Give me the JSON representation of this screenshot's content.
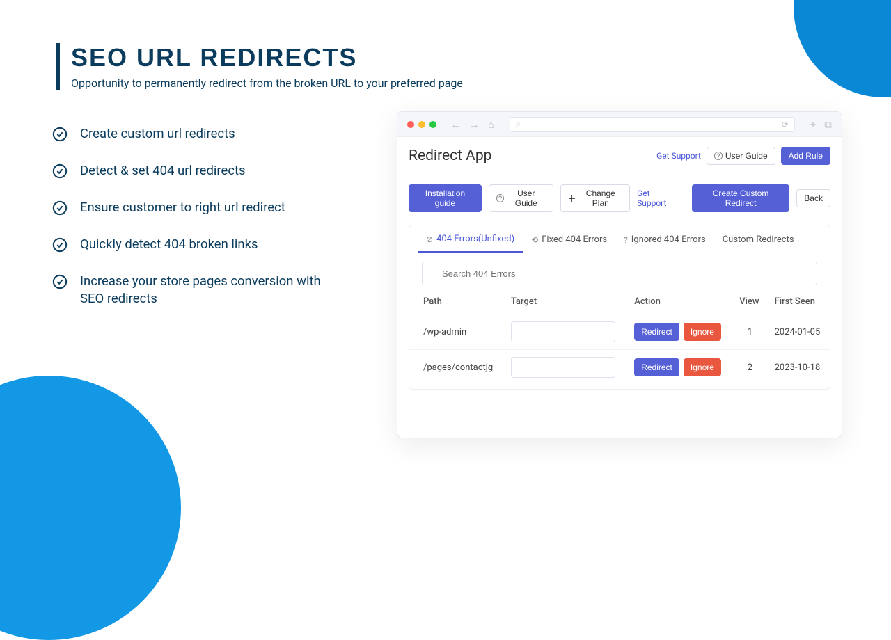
{
  "headline": {
    "title": "SEO URL REDIRECTS",
    "subtitle": "Opportunity to permanently redirect from the broken URL to your preferred page"
  },
  "features": [
    "Create custom url redirects",
    "Detect & set 404 url redirects",
    "Ensure customer to right url redirect",
    "Quickly detect 404 broken links",
    "Increase your store pages conversion with SEO redirects"
  ],
  "app": {
    "title": "Redirect App",
    "header_buttons": {
      "get_support": "Get Support",
      "user_guide": "User Guide",
      "add_rule": "Add Rule"
    },
    "toolbar": {
      "install_guide": "Installation guide",
      "user_guide": "User Guide",
      "change_plan": "Change Plan",
      "get_support": "Get Support",
      "create_redirect": "Create Custom Redirect",
      "back": "Back"
    },
    "tabs": {
      "unfixed": "404 Errors(Unfixed)",
      "fixed": "Fixed 404 Errors",
      "ignored": "Ignored 404 Errors",
      "custom": "Custom Redirects"
    },
    "search_placeholder": "Search 404 Errors",
    "columns": {
      "path": "Path",
      "target": "Target",
      "action": "Action",
      "view": "View",
      "first_seen": "First Seen"
    },
    "action_labels": {
      "redirect": "Redirect",
      "ignore": "Ignore"
    },
    "rows": [
      {
        "path": "/wp-admin",
        "target": "",
        "view": "1",
        "first_seen": "2024-01-05"
      },
      {
        "path": "/pages/contactjg",
        "target": "",
        "view": "2",
        "first_seen": "2023-10-18"
      }
    ]
  }
}
